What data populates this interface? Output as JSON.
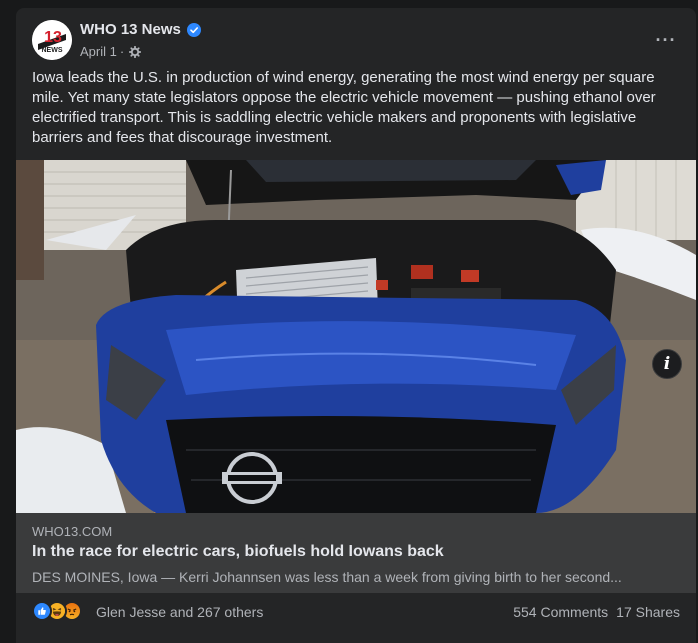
{
  "post": {
    "page_name": "WHO 13 News",
    "date": "April 1",
    "separator": "·",
    "text": "Iowa leads the U.S. in production of wind energy, generating the most wind energy per square mile. Yet many state legislators oppose the electric vehicle movement — pushing ethanol over electrified transport. This is saddling electric vehicle makers and proponents with legislative barriers and fees that discourage investment.",
    "more_icon": "three-dots-icon",
    "more_label": "···"
  },
  "avatar": {
    "logo_number": "13",
    "logo_word": "NEWS"
  },
  "link_preview": {
    "domain": "WHO13.COM",
    "title": "In the race for electric cars, biofuels hold Iowans back",
    "description": "DES MOINES, Iowa — Kerri Johannsen was less than a week from giving birth to her second..."
  },
  "image": {
    "info_label": "i"
  },
  "footer": {
    "reactions": [
      "like-icon",
      "haha-icon",
      "angry-icon"
    ],
    "reaction_names": "Glen Jesse and 267 others",
    "comments": "554 Comments",
    "shares": "17 Shares"
  },
  "colors": {
    "background": "#18191a",
    "card": "#242526",
    "link_box": "#3a3b3c",
    "verified_blue": "#2d88ff",
    "car_blue": "#1f3f9e",
    "logo_red": "#d4202c"
  }
}
